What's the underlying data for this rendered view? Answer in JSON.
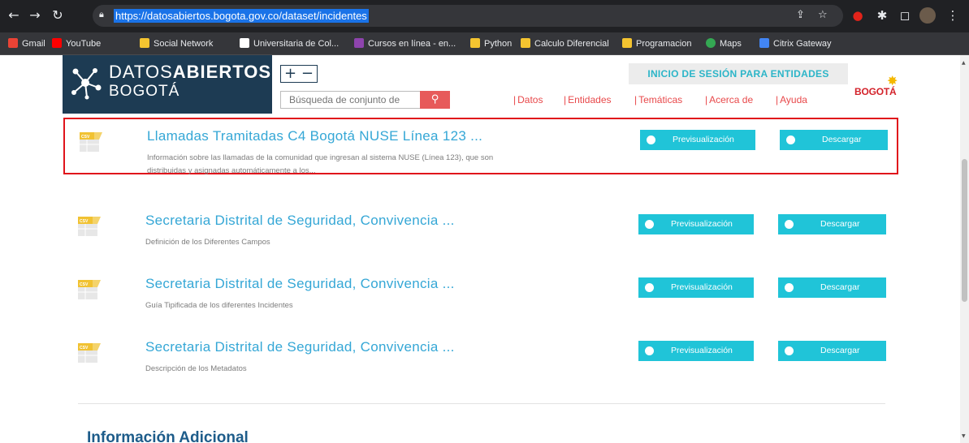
{
  "browser": {
    "url": "https://datosabiertos.bogota.gov.co/dataset/incidentes",
    "bookmarks": [
      {
        "label": "Gmail",
        "icon": "gmail-icon",
        "color": "#ea4335"
      },
      {
        "label": "YouTube",
        "icon": "youtube-icon",
        "color": "#ff0000"
      },
      {
        "label": "Social Network",
        "icon": "folder-icon",
        "color": "#f4c430"
      },
      {
        "label": "Universitaria de Col...",
        "icon": "universitaria-icon",
        "color": "#ffffff"
      },
      {
        "label": "Cursos en línea - en...",
        "icon": "cursos-icon",
        "color": "#8e44ad"
      },
      {
        "label": "Python",
        "icon": "folder-icon",
        "color": "#f4c430"
      },
      {
        "label": "Calculo Diferencial",
        "icon": "folder-icon",
        "color": "#f4c430"
      },
      {
        "label": "Programacion",
        "icon": "folder-icon",
        "color": "#f4c430"
      },
      {
        "label": "Maps",
        "icon": "maps-icon",
        "color": "#34a853"
      },
      {
        "label": "Citrix Gateway",
        "icon": "citrix-icon",
        "color": "#4285f4"
      }
    ]
  },
  "header": {
    "logo_line1_light": "DATOS",
    "logo_line1_bold": "ABIERTOS",
    "logo_line2": "BOGOTÁ",
    "zoom_label": "+ −",
    "search_placeholder": "Búsqueda de conjunto de",
    "login_label": "INICIO DE SESIÓN PARA ENTIDADES",
    "nav": [
      "Datos",
      "Entidades",
      "Temáticas",
      "Acerca de",
      "Ayuda"
    ],
    "city_logo": "BOGOTÁ"
  },
  "resources": [
    {
      "format": "CSV",
      "title": "Llamadas Tramitadas C4 Bogotá NUSE Línea 123 ...",
      "description": "Información sobre las llamadas de la comunidad que ingresan al sistema NUSE (Línea 123), que son distribuidas y asignadas automáticamente a los...",
      "highlighted": true
    },
    {
      "format": "CSV",
      "title": "Secretaria Distrital de Seguridad, Convivencia ...",
      "description": "Definición de los Diferentes Campos",
      "highlighted": false
    },
    {
      "format": "CSV",
      "title": "Secretaria Distrital de Seguridad, Convivencia ...",
      "description": "Guía Tipificada de los diferentes Incidentes",
      "highlighted": false
    },
    {
      "format": "CSV",
      "title": "Secretaria Distrital de Seguridad, Convivencia ...",
      "description": "Descripción de los Metadatos",
      "highlighted": false
    }
  ],
  "buttons": {
    "preview_label": "Previsualización",
    "download_label": "Descargar"
  },
  "section": {
    "info_heading": "Información Adicional"
  },
  "colors": {
    "accent": "#20c4d8",
    "title": "#35a7d6",
    "nav": "#e8484a",
    "highlight": "#e0141b",
    "logo_bg": "#1d3b53"
  }
}
